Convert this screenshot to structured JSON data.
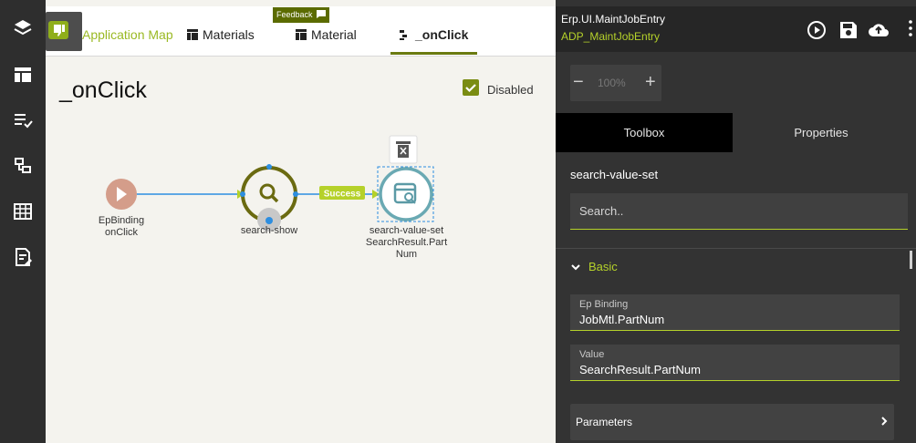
{
  "tabs": [
    {
      "label": "Application Map",
      "icon": "map-icon"
    },
    {
      "label": "Materials",
      "icon": "grid-icon"
    },
    {
      "label": "Material",
      "icon": "grid-icon"
    },
    {
      "label": "_onClick",
      "icon": "event-icon"
    }
  ],
  "feedback": {
    "label": "Feedback"
  },
  "page_title": "_onClick",
  "disabled": {
    "label": "Disabled",
    "checked": true
  },
  "flow": {
    "nodes": [
      {
        "name": "EpBinding",
        "sub": "onClick"
      },
      {
        "name": "search-show",
        "sub": ""
      },
      {
        "name": "search-value-set",
        "sub": "SearchResult.PartNum"
      }
    ],
    "edge_label": "Success"
  },
  "panel": {
    "app_name": "Erp.UI.MaintJobEntry",
    "app_sub": "ADP_MaintJobEntry",
    "zoom": "100%",
    "tabs": [
      "Toolbox",
      "Properties"
    ],
    "widget_title": "search-value-set",
    "search_placeholder": "Search..",
    "section": "Basic",
    "fields": [
      {
        "label": "Ep Binding",
        "value": "JobMtl.PartNum"
      },
      {
        "label": "Value",
        "value": "SearchResult.PartNum"
      }
    ],
    "parameters": "Parameters"
  },
  "colors": {
    "accent": "#b5d12a",
    "olive": "#6a7a10",
    "dark": "#333333"
  }
}
